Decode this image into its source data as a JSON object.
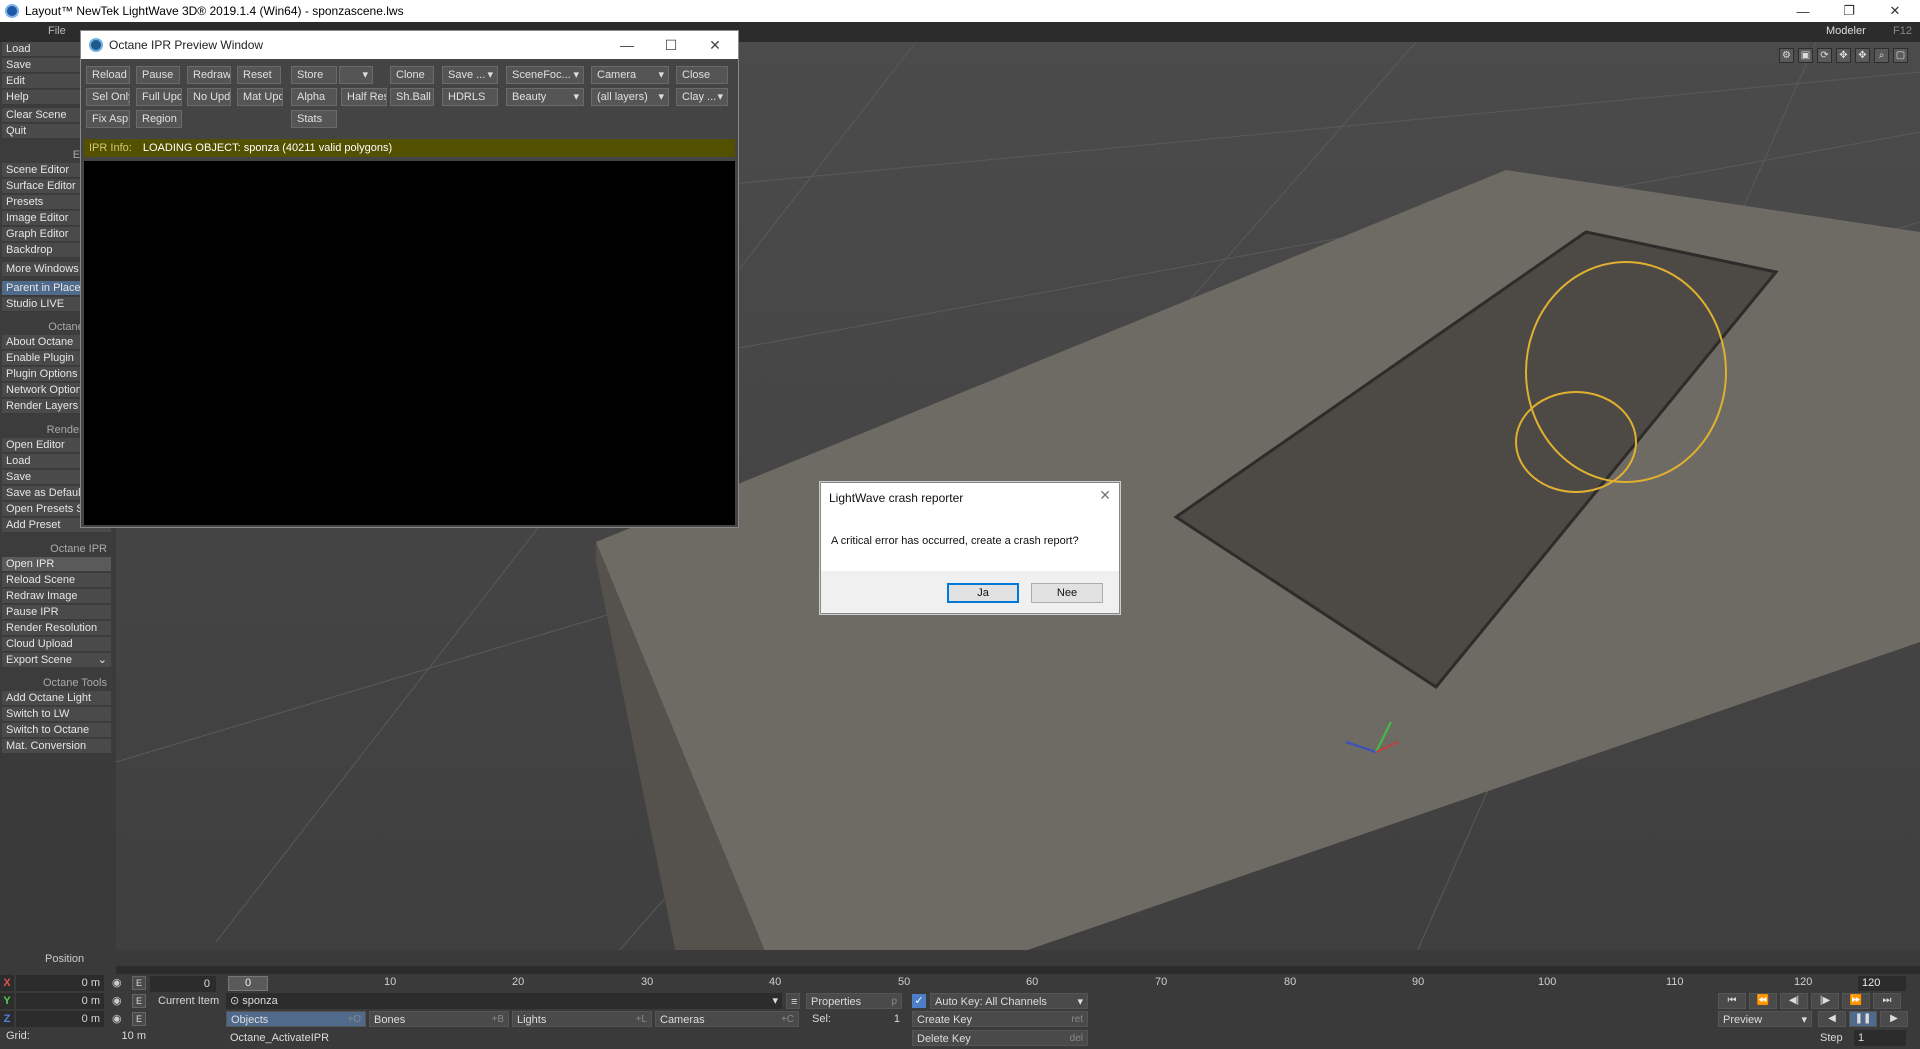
{
  "window": {
    "title": "Layout™ NewTek LightWave 3D® 2019.1.4 (Win64) - sponzascene.lws",
    "minimize": "—",
    "restore": "❐",
    "close": "✕"
  },
  "topstrip": {
    "file": "File",
    "modeler": "Modeler",
    "modeler_key": "F12"
  },
  "left_toolbar": {
    "file_items": [
      "Load",
      "Save",
      "Edit",
      "Help",
      "Clear Scene",
      "Quit"
    ],
    "editors_head": "Editors",
    "editors_items": [
      "Scene Editor",
      "Surface Editor",
      "Presets",
      "Image Editor",
      "Graph Editor",
      "Backdrop"
    ],
    "more_windows": "More Windows",
    "parent_in_place": "Parent in Place",
    "studio_live": "Studio LIVE",
    "octane_render_head": "Octane Ren",
    "octane_render_items": [
      "About Octane",
      "Enable Plugin",
      "Plugin Options",
      "Network Option",
      "Render Layers"
    ],
    "render_target_head": "Render Targ",
    "render_target_items": [
      "Open Editor",
      "Load",
      "Save",
      "Save as Default",
      "Open Presets S",
      "Add Preset"
    ],
    "octane_ipr_head": "Octane IPR",
    "octane_ipr_items": [
      "Open IPR",
      "Reload Scene",
      "Redraw Image",
      "Pause IPR",
      "Render Resolution",
      "Cloud Upload",
      "Export Scene"
    ],
    "octane_tools_head": "Octane Tools",
    "octane_tools_items": [
      "Add Octane Light",
      "Switch to LW",
      "Switch to Octane",
      "Mat. Conversion"
    ]
  },
  "ipr": {
    "title": "Octane IPR Preview Window",
    "row1": [
      "Reload",
      "Pause",
      "Redraw",
      "Reset",
      "Store",
      "",
      "Clone",
      "Save ...",
      "SceneFoc...",
      "Camera",
      "Close"
    ],
    "row2": [
      "Sel Only",
      "Full Upd.",
      "No Upd.",
      "Mat Upd",
      "Alpha",
      "Half Res",
      "Sh.Ball",
      "HDRLS",
      "Beauty",
      "(all layers)",
      "Clay ..."
    ],
    "row3": [
      "Fix Asp.",
      "Region",
      "Stats"
    ],
    "info_label": "IPR Info:",
    "info_text": "LOADING OBJECT: sponza (40211 valid polygons)"
  },
  "crash_dialog": {
    "title": "LightWave crash reporter",
    "message": "A critical error has occurred, create a crash report?",
    "yes": "Ja",
    "no": "Nee",
    "close": "✕"
  },
  "bottom": {
    "position_label": "Position",
    "axes": [
      {
        "axis": "X",
        "value": "0 m",
        "color": "#e05050"
      },
      {
        "axis": "Y",
        "value": "0 m",
        "color": "#50d050"
      },
      {
        "axis": "Z",
        "value": "0 m",
        "color": "#5080e0"
      }
    ],
    "grid_label": "Grid:",
    "grid_value": "10 m",
    "frame_value": "0",
    "current_item_label": "Current Item",
    "current_item": "sponza",
    "properties": "Properties",
    "properties_key": "p",
    "auto_key": "Auto Key: All Channels",
    "create_key": "Create Key",
    "create_key_shortcut": "ret",
    "delete_key": "Delete Key",
    "delete_key_shortcut": "del",
    "objects": "Objects",
    "objects_key": "+O",
    "bones": "Bones",
    "bones_key": "+B",
    "lights": "Lights",
    "lights_key": "+L",
    "cameras": "Cameras",
    "cameras_key": "+C",
    "sel_label": "Sel:",
    "sel_value": "1",
    "status_text": "Octane_ActivateIPR",
    "preview": "Preview",
    "step_label": "Step",
    "step_value": "1",
    "ruler_ticks": [
      "0",
      "10",
      "20",
      "30",
      "40",
      "50",
      "60",
      "70",
      "80",
      "90",
      "100",
      "110",
      "120"
    ],
    "slider_value": "0",
    "end_frame": "120"
  }
}
